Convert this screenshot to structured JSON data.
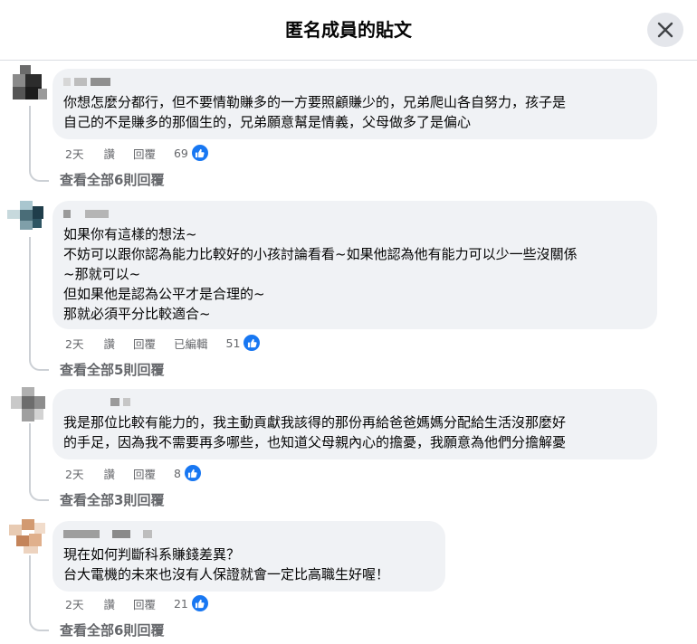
{
  "header": {
    "title": "匿名成員的貼文"
  },
  "comments": [
    {
      "text": "你想怎麼分都行，但不要情勒賺多的一方要照顧賺少的，兄弟爬山各自努力，孩子是\n自己的不是賺多的那個生的，兄弟願意幫是情義，父母做多了是偏心",
      "time": "2天",
      "like_label": "讚",
      "reply_label": "回覆",
      "likes": "69",
      "view_replies": "查看全部6則回覆"
    },
    {
      "text": "如果你有這樣的想法~\n不妨可以跟你認為能力比較好的小孩討論看看~如果他認為他有能力可以少一些沒關係\n~那就可以~\n但如果他是認為公平才是合理的~\n那就必須平分比較適合~",
      "time": "2天",
      "like_label": "讚",
      "reply_label": "回覆",
      "edited_label": "已編輯",
      "likes": "51",
      "view_replies": "查看全部5則回覆"
    },
    {
      "text": "我是那位比較有能力的，我主動貢獻我該得的那份再給爸爸媽媽分配給生活沒那麼好\n的手足，因為我不需要再多哪些，也知道父母親內心的擔憂，我願意為他們分擔解憂",
      "time": "2天",
      "like_label": "讚",
      "reply_label": "回覆",
      "likes": "8",
      "view_replies": "查看全部3則回覆"
    },
    {
      "text": "現在如何判斷科系賺錢差異？\n台大電機的未來也沒有人保證就會一定比高職生好喔！",
      "time": "2天",
      "like_label": "讚",
      "reply_label": "回覆",
      "likes": "21",
      "view_replies": "查看全部6則回覆"
    }
  ],
  "colors": {
    "like_blue": "#1877f2",
    "bubble_bg": "#f0f2f5",
    "meta_gray": "#65676b"
  },
  "icons": {
    "close": "close-icon",
    "like": "thumbs-up-icon"
  }
}
